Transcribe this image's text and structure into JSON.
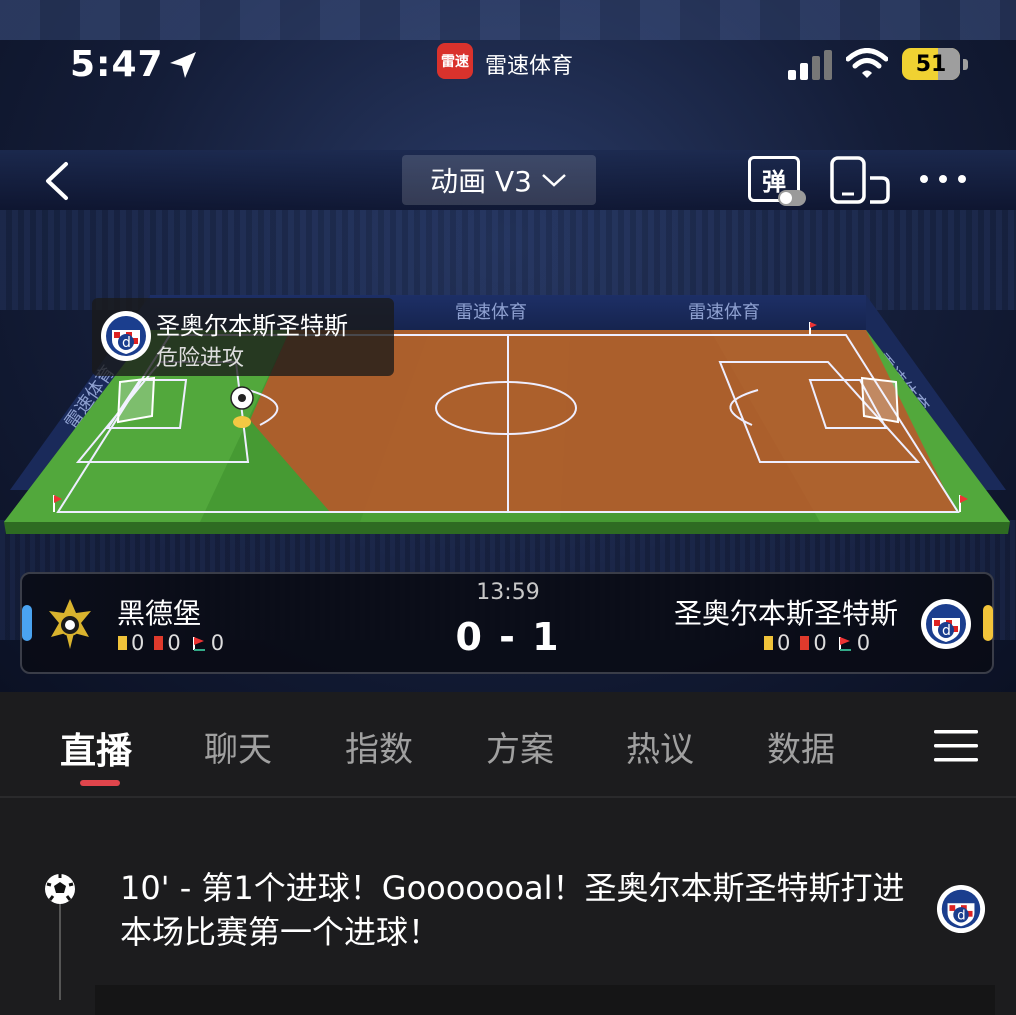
{
  "status_bar": {
    "time": "5:47",
    "app_name": "雷速体育",
    "app_badge": "雷速",
    "battery": "51"
  },
  "nav": {
    "animation_label": "动画 V3",
    "danmu_label": "弹"
  },
  "pitch": {
    "sponsor_1": "雷速体育",
    "sponsor_2": "雷速体育",
    "sponsor_side_left": "雷速体育",
    "sponsor_side_right": "雷速体育",
    "attack_team": "圣奥尔本斯圣特斯",
    "attack_status": "危险进攻",
    "colors": {
      "grass_dark": "#3e8a2e",
      "grass_light": "#56a83c",
      "danger": "#c4502a"
    }
  },
  "match": {
    "clock": "13:59",
    "score": "0 - 1",
    "home": {
      "name": "黑德堡",
      "yellow": "0",
      "red": "0",
      "corners": "0",
      "color": "#4aa3f0"
    },
    "away": {
      "name": "圣奥尔本斯圣特斯",
      "yellow": "0",
      "red": "0",
      "corners": "0",
      "color": "#f2c43a"
    }
  },
  "tabs": [
    {
      "label": "直播",
      "active": true
    },
    {
      "label": "聊天"
    },
    {
      "label": "指数"
    },
    {
      "label": "方案"
    },
    {
      "label": "热议"
    },
    {
      "label": "数据"
    }
  ],
  "feed": {
    "events": [
      {
        "text": "10' - 第1个进球！Gooooooal！圣奥尔本斯圣特斯打进本场比赛第一个进球！",
        "icon": "soccer-ball-icon"
      }
    ]
  },
  "icons": [
    "location-arrow-icon",
    "signal-icon",
    "wifi-icon",
    "battery-icon",
    "back-chevron-icon",
    "chevron-down-icon",
    "danmu-toggle-icon",
    "screen-rotate-icon",
    "more-icon",
    "menu-icon",
    "soccer-ball-icon"
  ]
}
